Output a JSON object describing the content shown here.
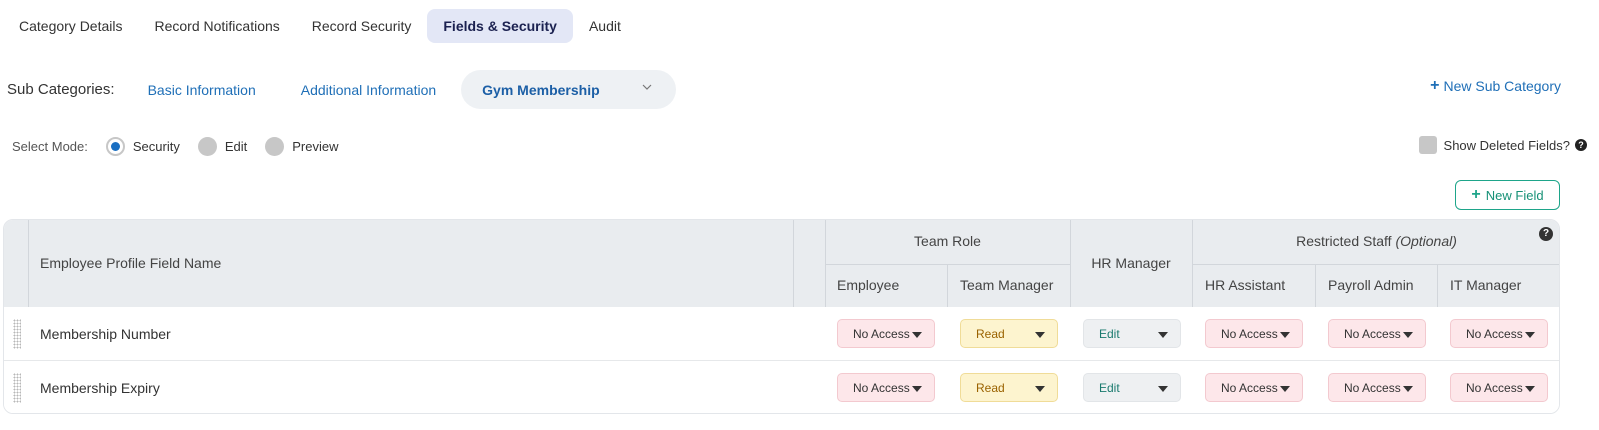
{
  "tabs": [
    {
      "label": "Category Details",
      "active": false
    },
    {
      "label": "Record Notifications",
      "active": false
    },
    {
      "label": "Record Security",
      "active": false
    },
    {
      "label": "Fields & Security",
      "active": true
    },
    {
      "label": "Audit",
      "active": false
    }
  ],
  "subcategories": {
    "label": "Sub Categories:",
    "items": [
      "Basic Information",
      "Additional Information"
    ],
    "active": "Gym Membership",
    "new_label": "New Sub Category"
  },
  "mode": {
    "label": "Select Mode:",
    "options": [
      {
        "label": "Security",
        "selected": true
      },
      {
        "label": "Edit",
        "selected": false
      },
      {
        "label": "Preview",
        "selected": false
      }
    ]
  },
  "show_deleted_label": "Show Deleted Fields?",
  "new_field_label": "New Field",
  "table": {
    "field_name_header": "Employee Profile Field Name",
    "groups": {
      "team_role": "Team Role",
      "hr_manager": "HR Manager",
      "restricted": "Restricted Staff",
      "restricted_note": "(Optional)"
    },
    "columns": [
      "Employee",
      "Team Manager",
      "HR Assistant",
      "Payroll Admin",
      "IT Manager"
    ],
    "rows": [
      {
        "name": "Membership Number",
        "access": [
          "No Access",
          "Read",
          "Edit",
          "No Access",
          "No Access",
          "No Access"
        ]
      },
      {
        "name": "Membership Expiry",
        "access": [
          "No Access",
          "Read",
          "Edit",
          "No Access",
          "No Access",
          "No Access"
        ]
      }
    ]
  },
  "colors": {
    "accent_blue": "#1f6fb7",
    "tab_active_bg": "#e3e7f6",
    "no_access_bg": "#fde7ea",
    "read_bg": "#fdf4cf",
    "edit_bg": "#eef0f2",
    "new_field_green": "#1ea58a"
  },
  "icons": {
    "plus": "plus-icon",
    "chevron": "chevron-down-icon",
    "help": "question-circle-icon",
    "drag": "drag-handle-icon",
    "caret": "caret-down-icon"
  }
}
